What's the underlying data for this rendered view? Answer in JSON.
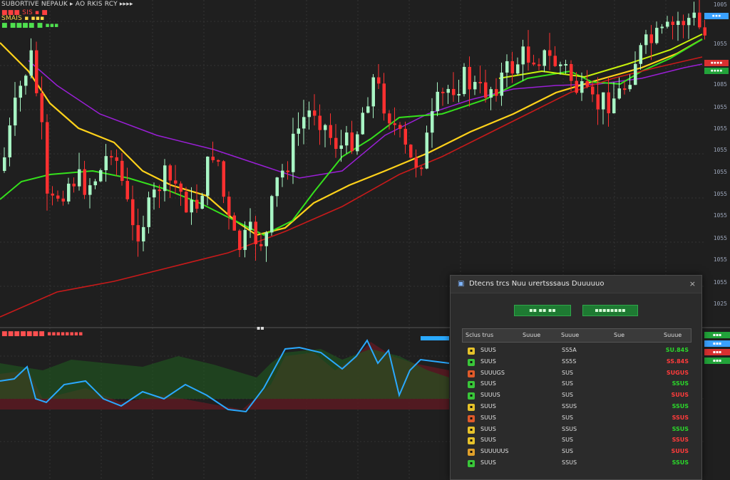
{
  "header": {
    "lines": [
      {
        "text": "SUBORTIVE  NEPAUK ▸ AO  RKIS RCY  ▸▸▸▸",
        "color": "#d8d8d8"
      },
      {
        "text": "■■■ SIS ▪ ■",
        "color": "#ff4040"
      },
      {
        "text": "SMAIS  ▪  ▪▪▪",
        "color": "#ffd84a"
      },
      {
        "text": "■ ■■■■  ■  ▪▪▪",
        "color": "#4fe04f"
      }
    ]
  },
  "indicator_header": {
    "text": "■■■■■■■  ▪▪▪▪▪▪▪▪",
    "label": "▪▪"
  },
  "price_axis": {
    "labels": [
      "1005",
      "1055",
      "1085",
      "1055",
      "1055",
      "1055",
      "1055",
      "1055",
      "1055",
      "1055",
      "1055",
      "1055",
      "1025"
    ],
    "tags": [
      {
        "text": "▪▪▪",
        "color": "#3aa1ff"
      },
      {
        "text": "▪▪▪▪",
        "color": "#d93030"
      },
      {
        "text": "▪▪▪▪",
        "color": "#22a33a"
      }
    ]
  },
  "colors": {
    "up": "#a8f5c4",
    "down": "#ff3030",
    "ma_purple": "#9a1fd6",
    "ma_yellow": "#ffd21a",
    "ma_green": "#35e11c",
    "ma_red": "#c81a1a",
    "ma_lime": "#c8f20c",
    "osc_blue": "#2aa9ff"
  },
  "panel": {
    "title": "Dtecns trcs  Nuu urertsssaus  Duuuuuo",
    "close": "×",
    "btn1": "▪▪   ▪▪   ▪▪",
    "btn2": "▪▪▪▪▪▪▪▪",
    "columns": [
      "Sclus trus",
      "Suuue",
      "Suuue",
      "Sue",
      "Suuue"
    ],
    "rows": [
      {
        "sym": "SUUS",
        "val": "SS5A",
        "chg": "SU.84S",
        "color": "#e6c22a",
        "up": true
      },
      {
        "sym": "SUUS",
        "val": "SS5S",
        "chg": "SS.84S",
        "color": "#39c639",
        "up": false
      },
      {
        "sym": "SUUUGS",
        "val": "SUS",
        "chg": "SUGUS",
        "color": "#e05a2a",
        "up": false
      },
      {
        "sym": "SUUS",
        "val": "SUS",
        "chg": "SSUS",
        "color": "#39c639",
        "up": true
      },
      {
        "sym": "SUUUS",
        "val": "SUS",
        "chg": "SUUS",
        "color": "#39c639",
        "up": false
      },
      {
        "sym": "SUUS",
        "val": "SSUS",
        "chg": "SSUS",
        "color": "#e6c22a",
        "up": true
      },
      {
        "sym": "SUUS",
        "val": "SUS",
        "chg": "SSUS",
        "color": "#e05a2a",
        "up": false
      },
      {
        "sym": "SUUS",
        "val": "SSUS",
        "chg": "SSUS",
        "color": "#e6c22a",
        "up": true
      },
      {
        "sym": "SUUS",
        "val": "SUS",
        "chg": "SSUS",
        "color": "#e6c22a",
        "up": false
      },
      {
        "sym": "SUUUUUS",
        "val": "SUS",
        "chg": "SUUS",
        "color": "#e0a02a",
        "up": false
      },
      {
        "sym": "SUUS",
        "val": "SSUS",
        "chg": "SSUS",
        "color": "#39c639",
        "up": true
      }
    ]
  },
  "right_mini": [
    {
      "text": "▪▪▪",
      "color": "#22a33a"
    },
    {
      "text": "▪▪▪",
      "color": "#3aa1ff"
    },
    {
      "text": "▪▪▪",
      "color": "#d93030"
    },
    {
      "text": "▪▪▪",
      "color": "#22a33a"
    }
  ]
}
